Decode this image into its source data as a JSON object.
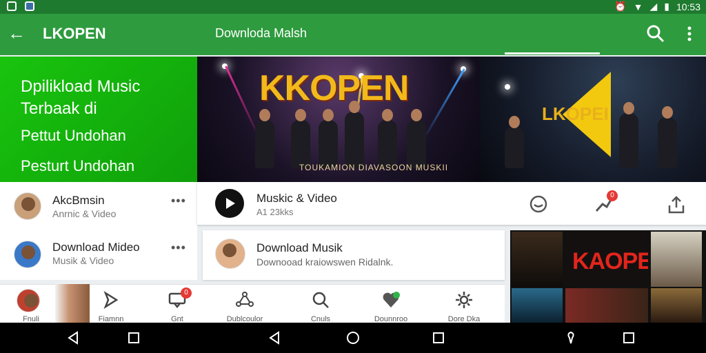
{
  "app": {
    "title": "LKOPEN",
    "subtitle": "Downloda Malsh"
  },
  "promo": {
    "line1": "Dpilikload Music Terbaak di",
    "line2": "Pettut Undohan",
    "line3": "Pesturt Undohan"
  },
  "banner": {
    "logo_main": "KKOPEN",
    "logo_secondary": "LKOPEI",
    "tagline": "TOUKAMION DIAVASOON MUSKII"
  },
  "list": [
    {
      "title": "AkcBmsin",
      "subtitle": "Anrnic & Video",
      "more": "•••"
    },
    {
      "title": "Download Mideo",
      "subtitle": "Musik & Video",
      "more": "•••"
    }
  ],
  "video_card": {
    "title": "Muskic & Video",
    "subtitle": "A1 23kks",
    "badge": "0"
  },
  "download_card": {
    "title": "Download Musik",
    "subtitle": "Downooad kraiowswen Ridalnk."
  },
  "grid": {
    "tile_text": "KAOPEN"
  },
  "bottom_nav": [
    {
      "label": "Fnuli",
      "icon": "avatar-icon"
    },
    {
      "label": "Fiamnn",
      "icon": "send-icon"
    },
    {
      "label": "Gnt",
      "icon": "chat-icon",
      "badge": "0"
    },
    {
      "label": "Dublcoulor",
      "icon": "network-icon"
    },
    {
      "label": "Cnuls",
      "icon": "search-icon"
    },
    {
      "label": "Dounnroo",
      "icon": "heart-icon"
    },
    {
      "label": "Dore Dka",
      "icon": "settings-icon"
    }
  ],
  "colors": {
    "statusbar": "#1e7a2e",
    "appbar": "#2e9b3e",
    "promo": "#19c40e",
    "accent_logo": "#f2b91a",
    "badge": "#e53935"
  }
}
